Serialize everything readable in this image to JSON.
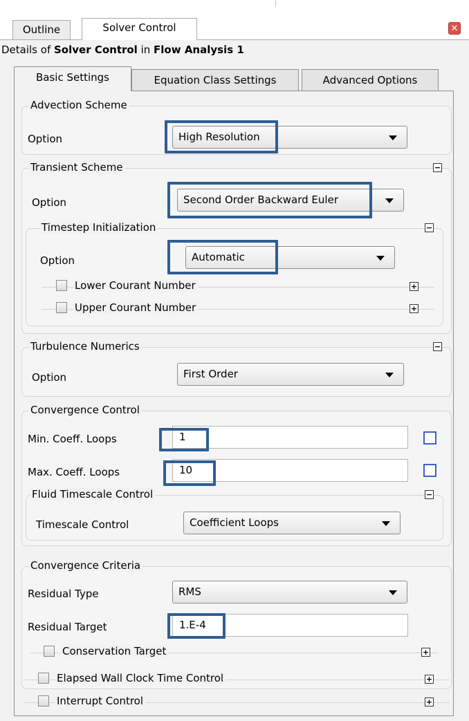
{
  "window_tabs": [
    "Outline",
    "Solver Control"
  ],
  "details": {
    "prefix": "Details of ",
    "object": "Solver Control",
    "middle": " in ",
    "analysis": "Flow Analysis 1"
  },
  "tabs": [
    "Basic Settings",
    "Equation Class Settings",
    "Advanced Options"
  ],
  "advection": {
    "title": "Advection Scheme",
    "option_label": "Option",
    "option_value": "High Resolution"
  },
  "transient": {
    "title": "Transient Scheme",
    "option_label": "Option",
    "option_value": "Second Order Backward Euler",
    "timestep": {
      "title": "Timestep Initialization",
      "option_label": "Option",
      "option_value": "Automatic",
      "lower_courant": "Lower Courant Number",
      "upper_courant": "Upper Courant Number"
    }
  },
  "turbulence": {
    "title": "Turbulence Numerics",
    "option_label": "Option",
    "option_value": "First Order"
  },
  "convergence_control": {
    "title": "Convergence Control",
    "min_label": "Min. Coeff. Loops",
    "min_value": "1",
    "max_label": "Max. Coeff. Loops",
    "max_value": "10",
    "fluid_timescale": {
      "title": "Fluid Timescale Control",
      "label": "Timescale Control",
      "value": "Coefficient Loops"
    }
  },
  "convergence_criteria": {
    "title": "Convergence Criteria",
    "residual_type_label": "Residual Type",
    "residual_type_value": "RMS",
    "residual_target_label": "Residual Target",
    "residual_target_value": "1.E-4",
    "conservation_target": "Conservation Target"
  },
  "elapsed_wall_clock": "Elapsed Wall Clock Time Control",
  "interrupt_control": "Interrupt Control",
  "icons": {
    "close": "close-icon",
    "collapse": "minus-box-icon",
    "expand": "plus-box-icon"
  },
  "colors": {
    "highlight": "#2e5e95",
    "close_button": "#d9534f",
    "checkbox_accent": "#3a5fcd"
  }
}
